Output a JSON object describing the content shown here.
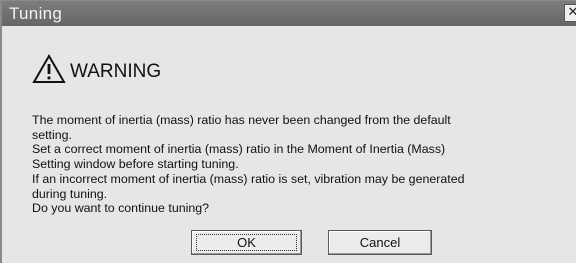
{
  "dialog": {
    "title": "Tuning",
    "close_glyph": "✕",
    "warning_icon": "warning-triangle-icon",
    "warning_title": "WARNING",
    "message_lines": [
      "The moment of inertia (mass) ratio has never been changed from the default",
      "setting.",
      "Set a correct moment of inertia (mass) ratio in the Moment of Inertia (Mass)",
      "Setting window before starting tuning.",
      "If an incorrect moment of inertia (mass) ratio is set, vibration may be generated",
      "during tuning.",
      "Do you want to continue tuning?"
    ],
    "buttons": {
      "ok_label": "OK",
      "cancel_label": "Cancel"
    }
  }
}
